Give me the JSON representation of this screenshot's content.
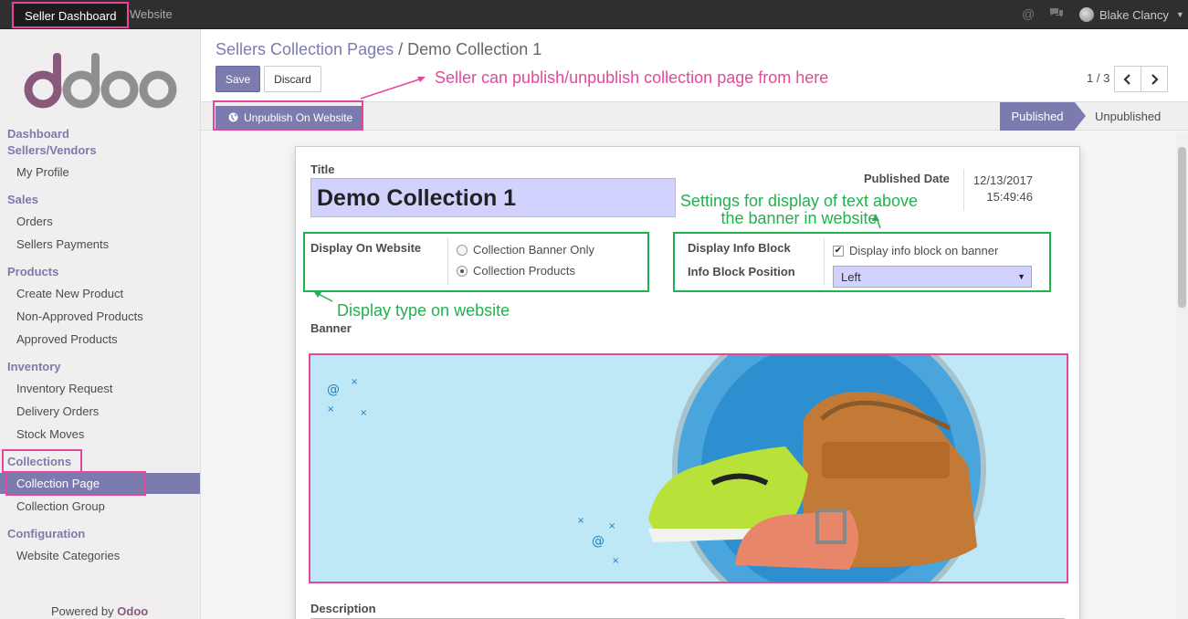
{
  "topbar": {
    "app_name": "Seller Dashboard",
    "website_label": "Website",
    "at_icon": "@",
    "user_name": "Blake Clancy"
  },
  "sidebar": {
    "sections": [
      {
        "label": "Dashboard"
      },
      {
        "label": "Sellers/Vendors"
      },
      {
        "label": "Sales"
      },
      {
        "label": "Products"
      },
      {
        "label": "Inventory"
      },
      {
        "label": "Collections"
      },
      {
        "label": "Configuration"
      }
    ],
    "items": [
      {
        "label": "My Profile"
      },
      {
        "label": "Orders"
      },
      {
        "label": "Sellers Payments"
      },
      {
        "label": "Create New Product"
      },
      {
        "label": "Non-Approved Products"
      },
      {
        "label": "Approved Products"
      },
      {
        "label": "Inventory Request"
      },
      {
        "label": "Delivery Orders"
      },
      {
        "label": "Stock Moves"
      },
      {
        "label": "Collection Page"
      },
      {
        "label": "Collection Group"
      },
      {
        "label": "Website Categories"
      }
    ],
    "powered_prefix": "Powered by",
    "powered_brand": "Odoo"
  },
  "breadcrumb": {
    "parent": "Sellers Collection Pages",
    "separator": "/",
    "current": "Demo Collection 1"
  },
  "buttons": {
    "save": "Save",
    "discard": "Discard",
    "unpublish": "Unpublish On Website"
  },
  "pager": {
    "value": "1 / 3"
  },
  "status": {
    "published": "Published",
    "unpublished": "Unpublished"
  },
  "form": {
    "title_label": "Title",
    "title_value": "Demo Collection 1",
    "published_date_label": "Published Date",
    "published_date": "12/13/2017",
    "published_time": "15:49:46",
    "display_on_website_label": "Display On Website",
    "radio_options": [
      "Collection Banner Only",
      "Collection Products"
    ],
    "display_info_block_label": "Display Info Block",
    "display_info_block_text": "Display info block on banner",
    "info_block_position_label": "Info Block Position",
    "info_block_position_value": "Left",
    "banner_label": "Banner",
    "description_label": "Description"
  },
  "annotations": {
    "publish_note": "Seller can publish/unpublish collection page from here",
    "info_block_note_line1": "Settings for display of text above",
    "info_block_note_line2": "the banner in website",
    "display_type_note": "Display type on website"
  },
  "colors": {
    "accent": "#7c7bad",
    "highlight_pink": "#e5479b",
    "highlight_green": "#21b14f",
    "topbar": "#2f2f2f"
  }
}
